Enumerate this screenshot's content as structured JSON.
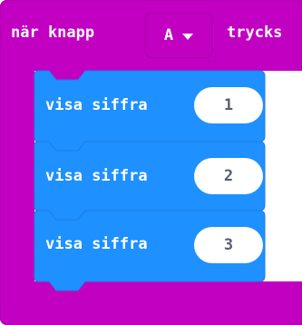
{
  "event_block": {
    "label": "när knapp",
    "dropdown_value": "A",
    "suffix": "trycks",
    "color": "#c200c2"
  },
  "statements": [
    {
      "label": "visa siffra",
      "value": "1"
    },
    {
      "label": "visa siffra",
      "value": "2"
    },
    {
      "label": "visa siffra",
      "value": "3"
    }
  ],
  "colors": {
    "event": "#c200c2",
    "basic": "#1e90ff",
    "basic_border": "#1c7fe3",
    "input_text": "#575e75"
  },
  "icons": {
    "dropdown": "triangle-down-icon"
  }
}
